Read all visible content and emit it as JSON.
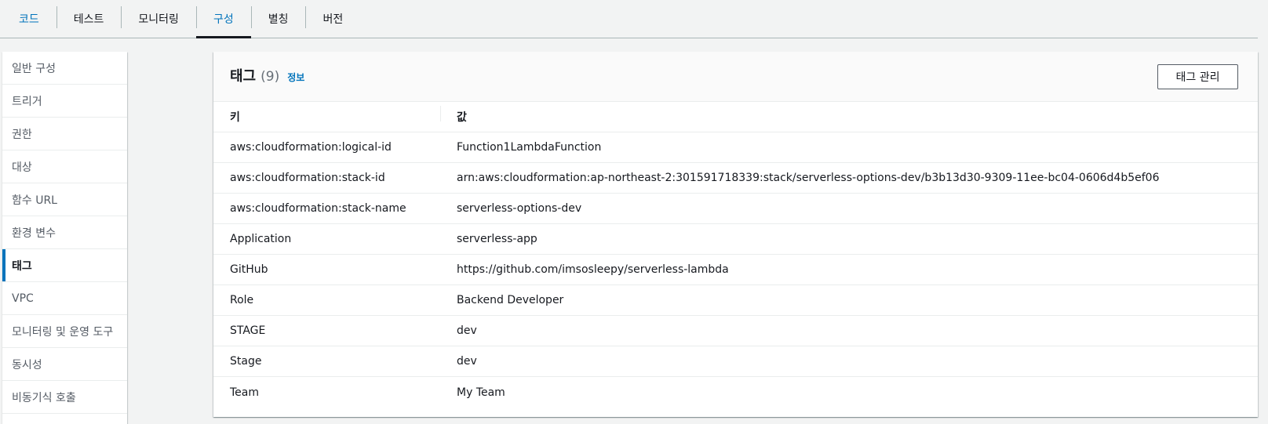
{
  "tabs": [
    {
      "label": "코드"
    },
    {
      "label": "테스트"
    },
    {
      "label": "모니터링"
    },
    {
      "label": "구성"
    },
    {
      "label": "별칭"
    },
    {
      "label": "버전"
    }
  ],
  "sidebar": {
    "items": [
      {
        "label": "일반 구성"
      },
      {
        "label": "트리거"
      },
      {
        "label": "권한"
      },
      {
        "label": "대상"
      },
      {
        "label": "함수 URL"
      },
      {
        "label": "환경 변수"
      },
      {
        "label": "태그"
      },
      {
        "label": "VPC"
      },
      {
        "label": "모니터링 및 운영 도구"
      },
      {
        "label": "동시성"
      },
      {
        "label": "비동기식 호출"
      }
    ],
    "active": "태그"
  },
  "tags_panel": {
    "title": "태그",
    "count": "(9)",
    "info_link": "정보",
    "manage_button": "태그 관리",
    "columns": {
      "key": "키",
      "value": "값"
    },
    "rows": [
      {
        "key": "aws:cloudformation:logical-id",
        "value": "Function1LambdaFunction"
      },
      {
        "key": "aws:cloudformation:stack-id",
        "value": "arn:aws:cloudformation:ap-northeast-2:301591718339:stack/serverless-options-dev/b3b13d30-9309-11ee-bc04-0606d4b5ef06"
      },
      {
        "key": "aws:cloudformation:stack-name",
        "value": "serverless-options-dev"
      },
      {
        "key": "Application",
        "value": "serverless-app"
      },
      {
        "key": "GitHub",
        "value": "https://github.com/imsosleepy/serverless-lambda"
      },
      {
        "key": "Role",
        "value": "Backend Developer"
      },
      {
        "key": "STAGE",
        "value": "dev"
      },
      {
        "key": "Stage",
        "value": "dev"
      },
      {
        "key": "Team",
        "value": "My Team"
      }
    ]
  },
  "colors": {
    "accent": "#0073bb",
    "background": "#f2f3f3",
    "text": "#16191f"
  }
}
